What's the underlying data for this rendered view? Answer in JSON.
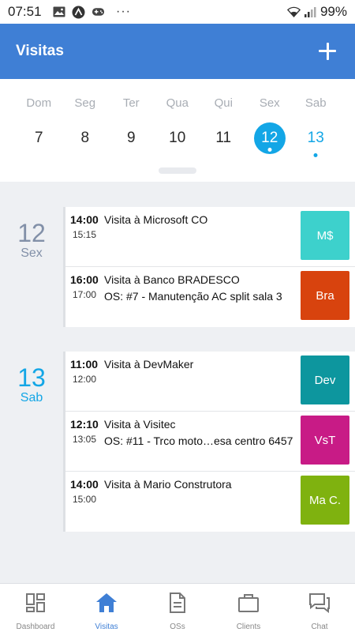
{
  "status_bar": {
    "time": "07:51",
    "battery": "99%",
    "icons": [
      "image-icon",
      "app-icon",
      "game-icon",
      "more-icon",
      "wifi-icon",
      "signal-icon",
      "battery-icon"
    ]
  },
  "header": {
    "title": "Visitas",
    "add_icon": "plus-icon",
    "background": "#3f7fd5"
  },
  "week": {
    "weekdays": [
      "Dom",
      "Seg",
      "Ter",
      "Qua",
      "Qui",
      "Sex",
      "Sab"
    ],
    "dates": [
      "7",
      "8",
      "9",
      "10",
      "11",
      "12",
      "13"
    ],
    "selected_date": "12",
    "accent": "#13a6e6"
  },
  "days": [
    {
      "day_num": "12",
      "day_name": "Sex",
      "visits": [
        {
          "start": "14:00",
          "end": "15:15",
          "title": "Visita à Microsoft CO",
          "subtitle": "",
          "badge": "M$",
          "badge_color": "#3dd1cc"
        },
        {
          "start": "16:00",
          "end": "17:00",
          "title": "Visita à Banco BRADESCO",
          "subtitle": "OS: #7 - Manutenção AC split sala 3",
          "badge": "Bra",
          "badge_color": "#d8430e"
        }
      ]
    },
    {
      "day_num": "13",
      "day_name": "Sab",
      "visits": [
        {
          "start": "11:00",
          "end": "12:00",
          "title": "Visita à DevMaker",
          "subtitle": "",
          "badge": "Dev",
          "badge_color": "#0d969e"
        },
        {
          "start": "12:10",
          "end": "13:05",
          "title": "Visita à Visitec",
          "subtitle": "OS: #11 - Trco moto…esa centro 6457",
          "badge": "VsT",
          "badge_color": "#c81b86"
        },
        {
          "start": "14:00",
          "end": "15:00",
          "title": "Visita à Mario Construtora",
          "subtitle": "",
          "badge": "Ma C.",
          "badge_color": "#7fb20f"
        }
      ]
    }
  ],
  "nav": {
    "items": [
      {
        "label": "Dashboard",
        "icon": "dashboard-icon"
      },
      {
        "label": "Visitas",
        "icon": "home-icon"
      },
      {
        "label": "OSs",
        "icon": "document-icon"
      },
      {
        "label": "Clients",
        "icon": "briefcase-icon"
      },
      {
        "label": "Chat",
        "icon": "chat-icon"
      }
    ],
    "active": "Visitas"
  }
}
